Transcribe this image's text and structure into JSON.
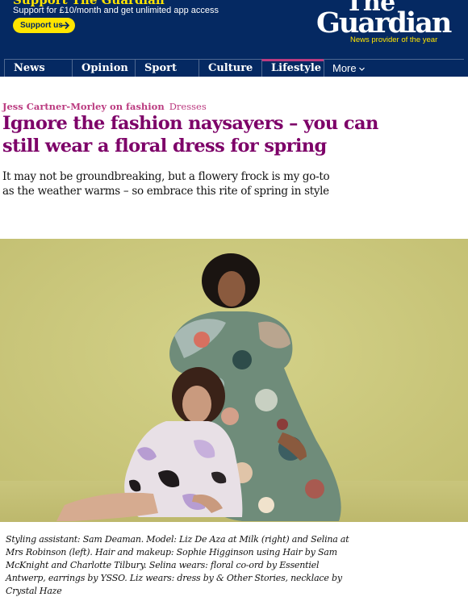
{
  "header": {
    "support_title": "Support The Guardian",
    "support_subtitle": "Support for £10/month and get unlimited app access",
    "support_button": "Support us",
    "logo_line1": "The",
    "logo_line2": "Guardian",
    "logo_tagline": "News provider of the year",
    "brand_color": "#052962",
    "accent_color": "#ffe500"
  },
  "nav": {
    "items": [
      {
        "label": "News"
      },
      {
        "label": "Opinion"
      },
      {
        "label": "Sport"
      },
      {
        "label": "Culture"
      },
      {
        "label": "Lifestyle",
        "active": true
      }
    ],
    "more_label": "More",
    "active_color": "#bb3b80"
  },
  "article": {
    "kicker_author": "Jess Cartner-Morley on fashion",
    "kicker_series": "Dresses",
    "headline": "Ignore the fashion naysayers – you can still wear a floral dress for spring",
    "standfirst": "It may not be groundbreaking, but a flowery frock is my go-to as the weather warms – so embrace this rite of spring in style",
    "headline_color": "#7d0068",
    "image_description_icon": "photo",
    "caption": "Styling assistant: Sam Deaman. Model: Liz De Aza at Milk (right) and Selina at Mrs Robinson (left). Hair and makeup: Sophie Higginson using Hair by Sam McKnight and Charlotte Tilbury. Selina wears: floral co-ord by Essentiel Antwerp, earrings by YSSO. Liz wears: dress by & Other Stories, necklace by Crystal Haze"
  }
}
